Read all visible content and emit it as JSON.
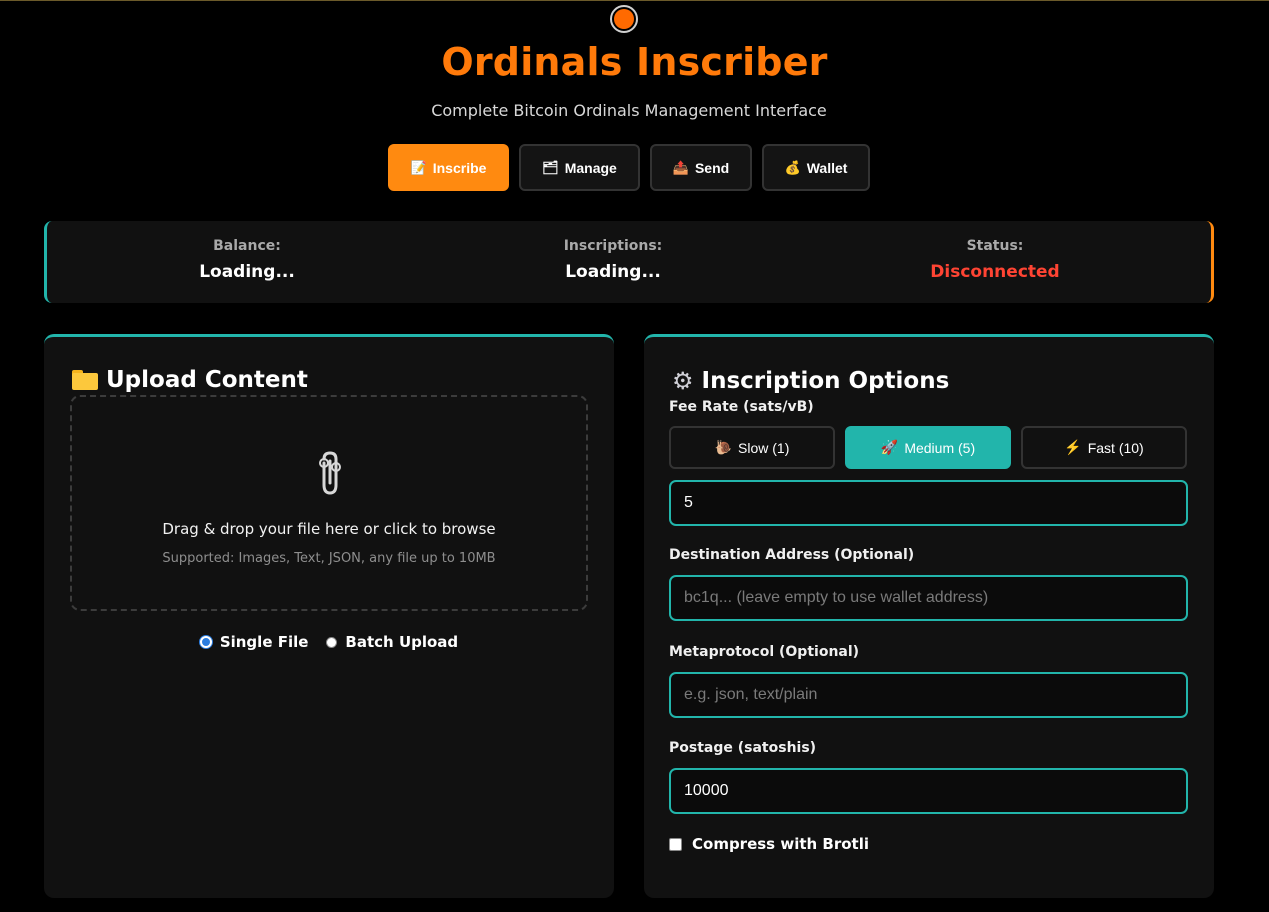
{
  "app": {
    "title": "Ordinals Inscriber",
    "subtitle": "Complete Bitcoin Ordinals Management Interface"
  },
  "nav": {
    "tabs": [
      {
        "label": "Inscribe",
        "icon": "📝",
        "active": true
      },
      {
        "label": "Manage",
        "icon": "🗂",
        "active": false
      },
      {
        "label": "Send",
        "icon": "📤",
        "active": false
      },
      {
        "label": "Wallet",
        "icon": "💰",
        "active": false
      }
    ]
  },
  "status": {
    "balance_label": "Balance:",
    "balance_value": "Loading...",
    "inscriptions_label": "Inscriptions:",
    "inscriptions_value": "Loading...",
    "status_label": "Status:",
    "status_value": "Disconnected"
  },
  "upload": {
    "title": "Upload Content",
    "drop_text": "Drag & drop your file here or click to browse",
    "supported_text": "Supported: Images, Text, JSON, any file up to 10MB",
    "mode_single": "Single File",
    "mode_batch": "Batch Upload",
    "selected_mode": "Single File"
  },
  "options": {
    "title": "Inscription Options",
    "fee_label": "Fee Rate (sats/vB)",
    "fee_presets": [
      {
        "label": "Slow (1)",
        "icon": "🐌",
        "active": false
      },
      {
        "label": "Medium (5)",
        "icon": "🚀",
        "active": true
      },
      {
        "label": "Fast (10)",
        "icon": "⚡",
        "active": false
      }
    ],
    "fee_value": "5",
    "destination_label": "Destination Address (Optional)",
    "destination_placeholder": "bc1q... (leave empty to use wallet address)",
    "metaprotocol_label": "Metaprotocol (Optional)",
    "metaprotocol_placeholder": "e.g. json, text/plain",
    "postage_label": "Postage (satoshis)",
    "postage_value": "10000",
    "compress_label": "Compress with Brotli",
    "compress_checked": false
  },
  "colors": {
    "accent_orange": "#ff8a10",
    "accent_teal": "#22b5ab",
    "error_red": "#ff4433",
    "background": "#000000",
    "panel": "#111111"
  }
}
